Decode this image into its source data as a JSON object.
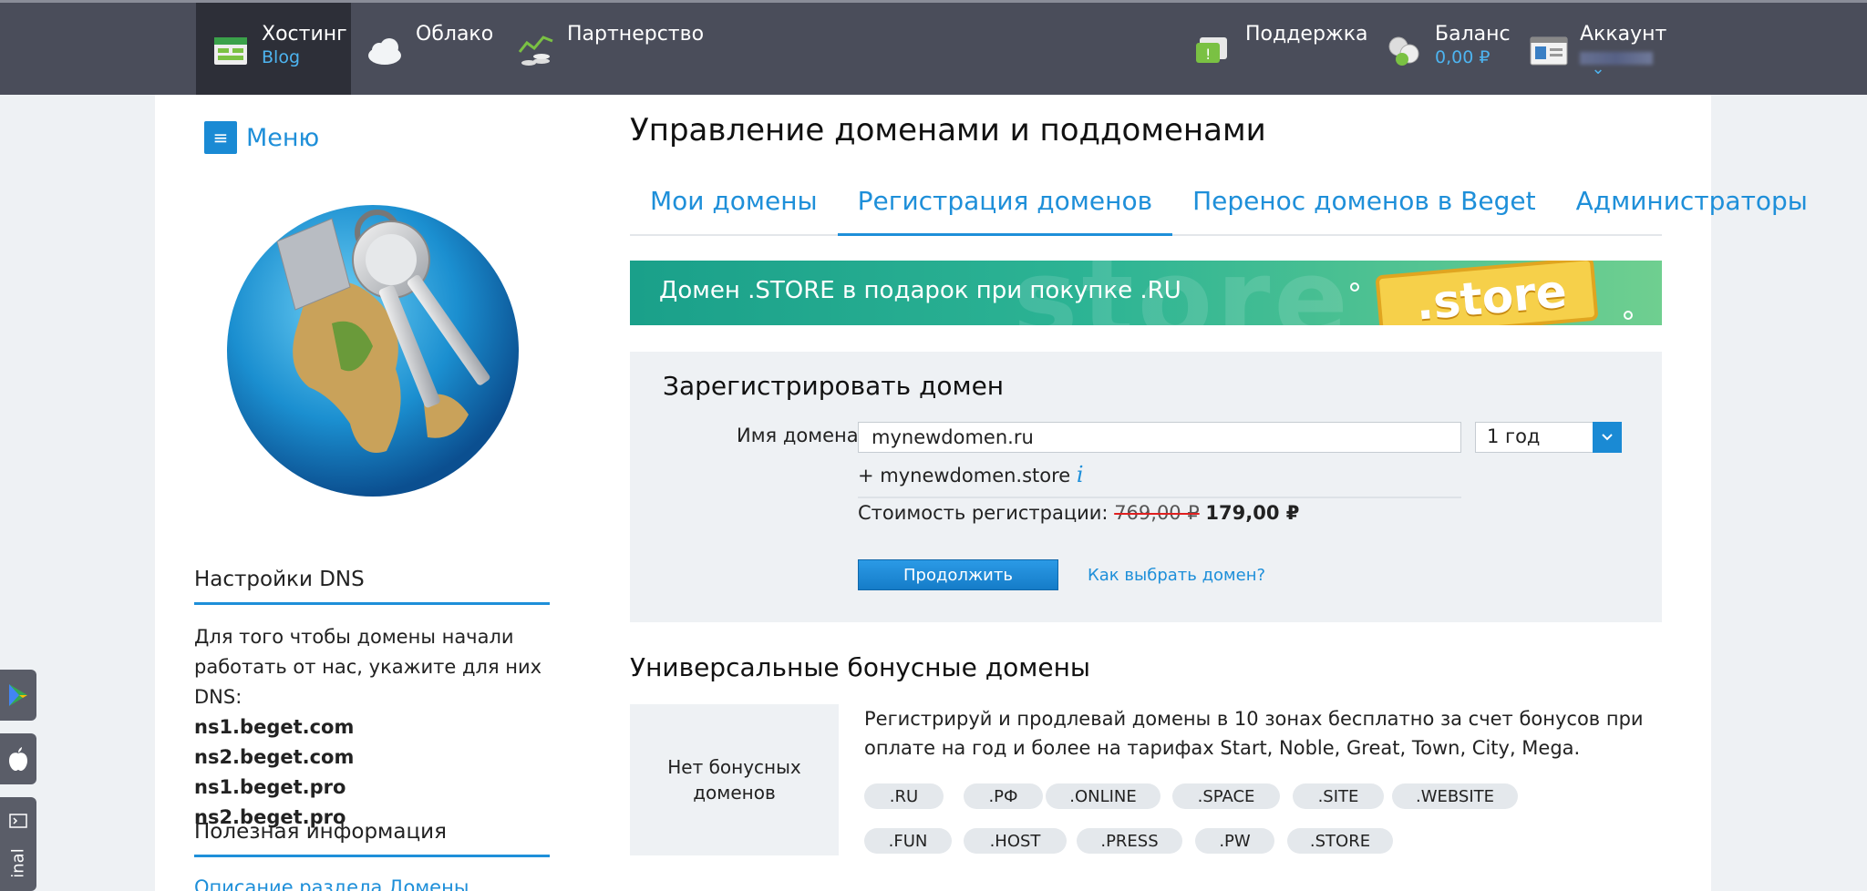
{
  "topnav": {
    "hosting": {
      "label": "Хостинг",
      "sub": "Blog"
    },
    "cloud": {
      "label": "Облако"
    },
    "partnership": {
      "label": "Партнерство"
    },
    "support": {
      "label": "Поддержка"
    },
    "balance": {
      "label": "Баланс",
      "sub": "0,00 ₽"
    },
    "account": {
      "label": "Аккаунт",
      "chevron": "⌄"
    }
  },
  "sidebar": {
    "menu_label": "Меню",
    "menu_icon": "≡",
    "dns_heading": "Настройки DNS",
    "dns_text": "Для того чтобы домены начали работать от нас, укажите для них DNS:",
    "dns_servers": [
      "ns1.beget.com",
      "ns2.beget.com",
      "ns1.beget.pro",
      "ns2.beget.pro"
    ],
    "useful_heading": "Полезная информация",
    "useful_link": "Описание раздела Домены"
  },
  "main": {
    "title": "Управление доменами и поддоменами",
    "tabs": [
      "Мои домены",
      "Регистрация доменов",
      "Перенос доменов в Beget",
      "Администраторы"
    ],
    "active_tab": "Регистрация доменов",
    "banner": {
      "text": "Домен .STORE в подарок при покупке .RU",
      "sign": ".store",
      "bg_word": "store"
    },
    "register": {
      "title": "Зарегистрировать домен",
      "domain_label": "Имя домена:",
      "domain_value": "mynewdomen.ru",
      "period": "1 год",
      "addon": "+ mynewdomen.store",
      "addon_info": "i",
      "price_label": "Стоимость регистрации:",
      "price_old": "769,00 ₽",
      "price_new": "179,00 ₽",
      "continue_button": "Продолжить",
      "help_link": "Как выбрать домен?"
    },
    "bonus": {
      "title": "Универсальные бонусные домены",
      "empty": "Нет бонусных доменов",
      "description": "Регистрируй и продлевай домены в 10 зонах бесплатно за счет бонусов при оплате на год и более на тарифах Start, Noble, Great, Town, City, Mega.",
      "zones": [
        ".RU",
        ".РФ",
        ".ONLINE",
        ".SPACE",
        ".SITE",
        ".WEBSITE",
        ".FUN",
        ".HOST",
        ".PRESS",
        ".PW",
        ".STORE"
      ]
    }
  },
  "float_tabs": {
    "terminal_label": "inal"
  },
  "colors": {
    "accent": "#1e8fd9",
    "topbar": "#4a4d5a",
    "banner": "#2db494"
  }
}
